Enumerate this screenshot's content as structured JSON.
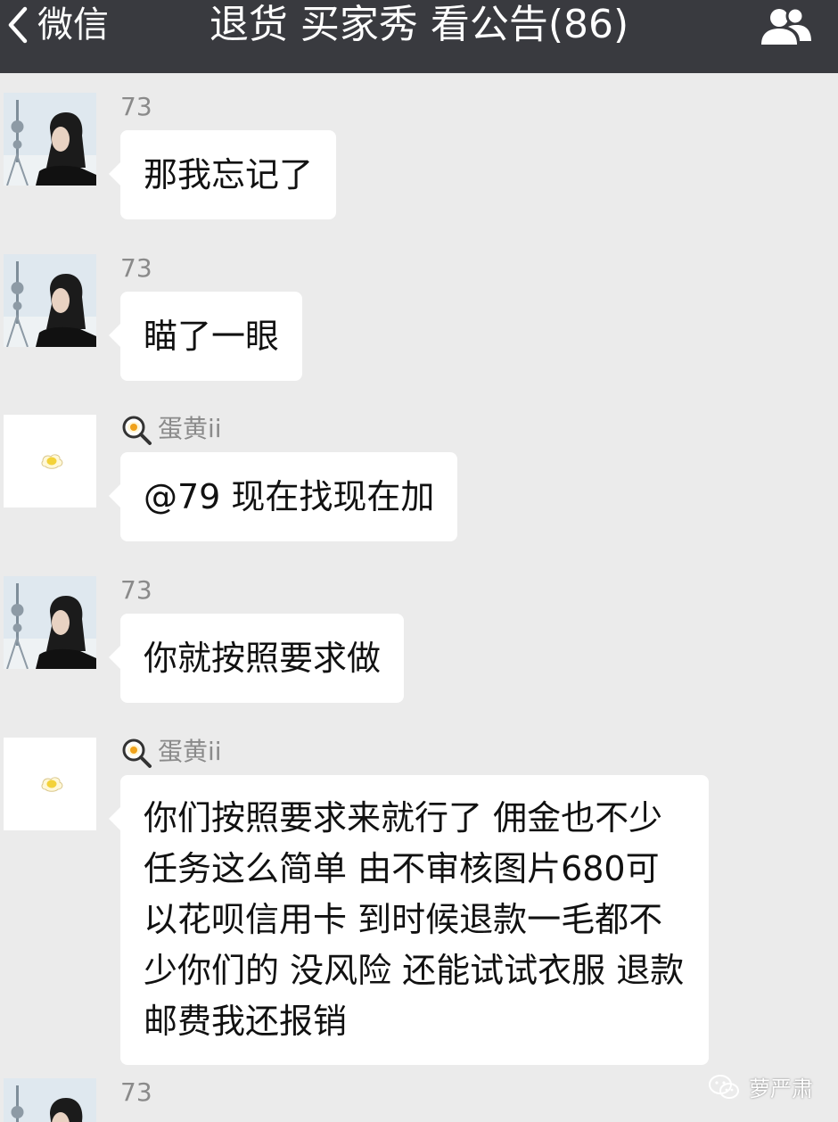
{
  "nav": {
    "back_label": "微信",
    "title": "退货 买家秀 看公告(86)"
  },
  "messages": [
    {
      "sender": "73",
      "text": "那我忘记了"
    },
    {
      "sender": "73",
      "text": "瞄了一眼"
    },
    {
      "sender": "蛋黄ii",
      "text": "@79 现在找现在加"
    },
    {
      "sender": "73",
      "text": "你就按照要求做"
    },
    {
      "sender": "蛋黄ii",
      "text": "你们按照要求来就行了 佣金也不少 任务这么简单 由不审核图片680可以花呗信用卡 到时候退款一毛都不少你们的 没风险 还能试试衣服 退款邮费我还报销"
    },
    {
      "sender": "73"
    }
  ],
  "watermark": "萝严肃",
  "colors": {
    "nav_bg": "#393a3f",
    "chat_bg": "#ebebeb",
    "bubble_bg": "#ffffff",
    "sender_text": "#8a8a8a"
  },
  "icons": {
    "back": "chevron-left-icon",
    "group": "group-members-icon",
    "sender_badge": "magnifier-egg-icon",
    "watermark": "wechat-logo-icon"
  }
}
